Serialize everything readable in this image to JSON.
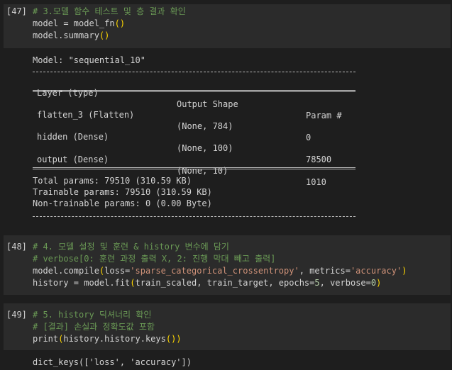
{
  "cells": [
    {
      "prompt": "[47]",
      "lines": [
        {
          "segments": [
            {
              "t": "# 3.모델 함수 테스트 및 층 결과 확인",
              "c": "comment"
            }
          ]
        },
        {
          "segments": [
            {
              "t": "model = model_fn",
              "c": "plain"
            },
            {
              "t": "()",
              "c": "paren"
            }
          ]
        },
        {
          "segments": [
            {
              "t": "model.summary",
              "c": "plain"
            },
            {
              "t": "()",
              "c": "paren"
            }
          ]
        }
      ],
      "output": {
        "model_line": "Model: \"sequential_10\"",
        "headers": [
          "Layer (type)",
          "Output Shape",
          "Param #"
        ],
        "rows": [
          [
            "flatten_3 (Flatten)",
            "(None, 784)",
            "0"
          ],
          [
            "hidden (Dense)",
            "(None, 100)",
            "78500"
          ],
          [
            "output (Dense)",
            "(None, 10)",
            "1010"
          ]
        ],
        "totals": [
          "Total params: 79510 (310.59 KB)",
          "Trainable params: 79510 (310.59 KB)",
          "Non-trainable params: 0 (0.00 Byte)"
        ]
      }
    },
    {
      "prompt": "[48]",
      "lines": [
        {
          "segments": [
            {
              "t": "# 4. 모델 설정 및 훈련 & history 변수에 담기",
              "c": "comment"
            }
          ]
        },
        {
          "segments": [
            {
              "t": "# verbose[0: 훈련 과정 출력 X, 2: 진행 막대 빼고 출력]",
              "c": "comment"
            }
          ]
        },
        {
          "segments": [
            {
              "t": "model.compile",
              "c": "plain"
            },
            {
              "t": "(",
              "c": "paren"
            },
            {
              "t": "loss=",
              "c": "plain"
            },
            {
              "t": "'sparse_categorical_crossentropy'",
              "c": "str"
            },
            {
              "t": ", metrics=",
              "c": "plain"
            },
            {
              "t": "'accuracy'",
              "c": "str"
            },
            {
              "t": ")",
              "c": "paren"
            }
          ]
        },
        {
          "segments": [
            {
              "t": "history = model.fit",
              "c": "plain"
            },
            {
              "t": "(",
              "c": "paren"
            },
            {
              "t": "train_scaled, train_target, epochs=",
              "c": "plain"
            },
            {
              "t": "5",
              "c": "num"
            },
            {
              "t": ", verbose=",
              "c": "plain"
            },
            {
              "t": "0",
              "c": "num"
            },
            {
              "t": ")",
              "c": "paren"
            }
          ]
        }
      ]
    },
    {
      "prompt": "[49]",
      "lines": [
        {
          "segments": [
            {
              "t": "# 5. history 딕셔너리 확인",
              "c": "comment"
            }
          ]
        },
        {
          "segments": [
            {
              "t": "# [결과] 손실과 정확도값 포함",
              "c": "comment"
            }
          ]
        },
        {
          "segments": [
            {
              "t": "print",
              "c": "plain"
            },
            {
              "t": "(",
              "c": "paren"
            },
            {
              "t": "history.history.keys",
              "c": "plain"
            },
            {
              "t": "()",
              "c": "paren"
            },
            {
              "t": ")",
              "c": "paren"
            }
          ]
        }
      ],
      "output_text": "dict_keys(['loss', 'accuracy'])"
    }
  ]
}
